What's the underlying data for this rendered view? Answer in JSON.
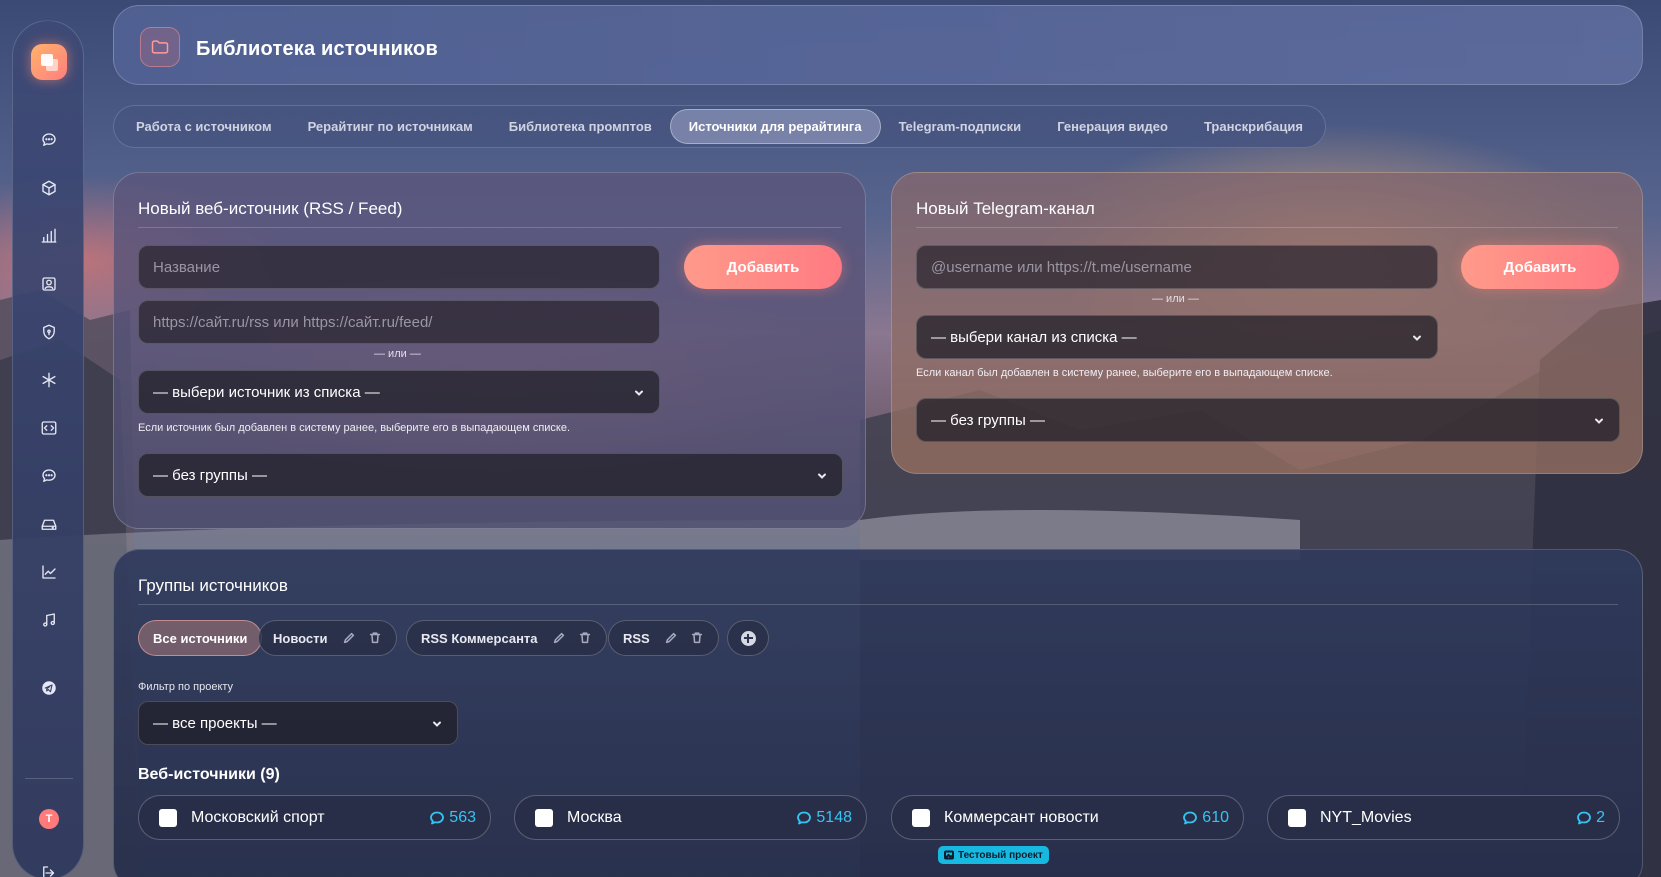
{
  "header": {
    "title": "Библиотека источников",
    "icon": "folder-icon"
  },
  "sidebar": {
    "logo": "app-logo",
    "items": [
      {
        "name": "chat",
        "icon": "chat-bubble-icon"
      },
      {
        "name": "box",
        "icon": "box-icon"
      },
      {
        "name": "stats",
        "icon": "bar-chart-icon"
      },
      {
        "name": "profile",
        "icon": "contact-card-icon"
      },
      {
        "name": "security",
        "icon": "shield-icon"
      },
      {
        "name": "asterisk",
        "icon": "asterisk-icon"
      },
      {
        "name": "code",
        "icon": "code-icon"
      },
      {
        "name": "messages",
        "icon": "chat-bubble-icon"
      },
      {
        "name": "storage",
        "icon": "drive-icon"
      },
      {
        "name": "trends",
        "icon": "trend-line-icon"
      },
      {
        "name": "music",
        "icon": "music-icon"
      },
      {
        "name": "telegram",
        "icon": "telegram-icon"
      }
    ],
    "avatar_letter": "T",
    "logout_icon": "logout-icon"
  },
  "tabs": [
    {
      "label": "Работа с источником",
      "active": false
    },
    {
      "label": "Рерайтинг по источникам",
      "active": false
    },
    {
      "label": "Библиотека промптов",
      "active": false
    },
    {
      "label": "Источники для рерайтинга",
      "active": true
    },
    {
      "label": "Telegram-подписки",
      "active": false
    },
    {
      "label": "Генерация видео",
      "active": false
    },
    {
      "label": "Транскрибация",
      "active": false
    }
  ],
  "web_source": {
    "title": "Новый веб-источник (RSS / Feed)",
    "name_placeholder": "Название",
    "url_placeholder": "https://сайт.ru/rss или https://сайт.ru/feed/",
    "add_label": "Добавить",
    "or_label": "— или —",
    "select_value": "— выбери источник из списка —",
    "hint": "Если источник был добавлен в систему ранее, выберите его в выпадающем списке.",
    "group_value": "— без группы —"
  },
  "telegram_source": {
    "title": "Новый Telegram-канал",
    "username_placeholder": "@username или https://t.me/username",
    "add_label": "Добавить",
    "or_label": "— или —",
    "select_value": "— выбери канал из списка —",
    "hint": "Если канал был добавлен в систему ранее, выберите его в выпадающем списке.",
    "group_value": "— без группы —"
  },
  "groups": {
    "title": "Группы источников",
    "chips": [
      {
        "label": "Все источники",
        "active": true,
        "editable": false
      },
      {
        "label": "Новости",
        "active": false,
        "editable": true
      },
      {
        "label": "RSS Коммерсанта",
        "active": false,
        "editable": true
      },
      {
        "label": "RSS",
        "active": false,
        "editable": true
      }
    ],
    "filter_label": "Фильтр по проекту",
    "filter_value": "— все проекты —",
    "web_sources_title": "Веб-источники (9)",
    "sources": [
      {
        "name": "Московский спорт",
        "count": "563"
      },
      {
        "name": "Москва",
        "count": "5148"
      },
      {
        "name": "Коммерсант новости",
        "count": "610"
      },
      {
        "name": "NYT_Movies",
        "count": "2"
      }
    ],
    "project_badge": "Тестовый проект"
  },
  "colors": {
    "accent": "#ff8a86",
    "count_blue": "#35c4f2",
    "badge": "#18b9e0"
  }
}
